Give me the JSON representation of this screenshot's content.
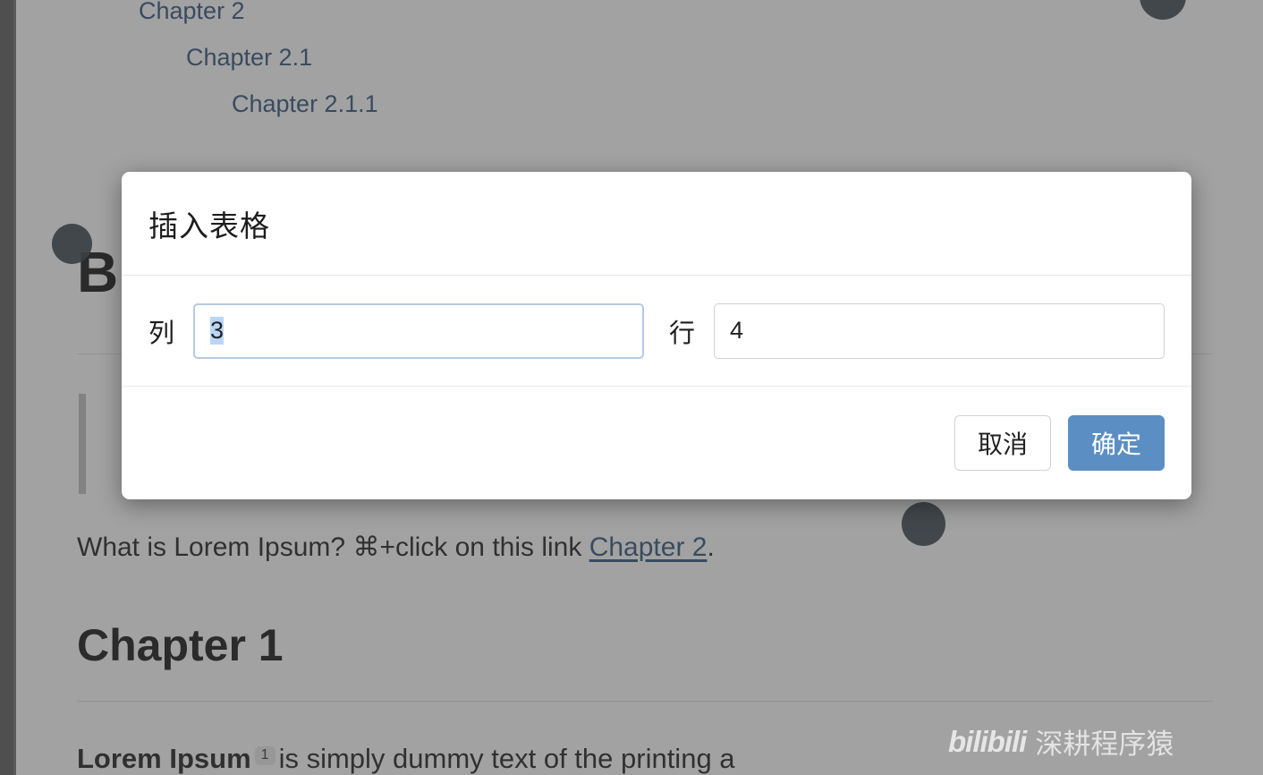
{
  "document": {
    "toc": [
      {
        "label": "Chapter 2",
        "level": 1
      },
      {
        "label": "Chapter 2.1",
        "level": 2
      },
      {
        "label": "Chapter 2.1.1",
        "level": 3
      }
    ],
    "heading_fragment": "B",
    "link_paragraph": {
      "before": "What is Lorem Ipsum? ⌘+click on this link ",
      "link": "Chapter 2",
      "after": "."
    },
    "chapter_heading": "Chapter 1",
    "body_paragraph": {
      "lead": "Lorem Ipsum",
      "footnote_ref": "1",
      "rest": "is simply dummy text of the printing a"
    }
  },
  "dialog": {
    "title": "插入表格",
    "fields": [
      {
        "name": "columns",
        "label": "列",
        "value": "3",
        "placeholder": "",
        "focused": true
      },
      {
        "name": "rows",
        "label": "行",
        "value": "4",
        "placeholder": "",
        "focused": false
      }
    ],
    "buttons": {
      "cancel": "取消",
      "confirm": "确定"
    }
  },
  "colors": {
    "primary": "#5b8fc4",
    "link": "#2d5078",
    "overlay": "rgba(70,70,70,0.50)",
    "focus_border": "#b6c9e0",
    "selection": "#b9d6f7",
    "annotation_dot": "#3a3f44"
  },
  "watermark": {
    "logo": "bilibili",
    "text": "深耕程序猿"
  }
}
